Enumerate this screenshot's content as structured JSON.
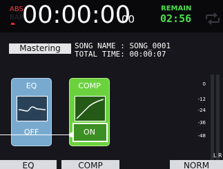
{
  "counter": {
    "abs_label": "ABS",
    "bar_label": "BAR",
    "time": "00:00:00",
    "frames": "00",
    "remain_label": "REMAIN",
    "remain_value": "02:56",
    "repeat_icon": "repeat-icon"
  },
  "song": {
    "mode_label": "Mastering",
    "name_line": "SONG NAME : SONG_0001",
    "time_line": "TOTAL TIME: 00:00:07"
  },
  "modules": {
    "eq": {
      "title": "EQ",
      "state": "OFF",
      "graph_icon": "eq-curve-icon"
    },
    "comp": {
      "title": "COMP",
      "state": "ON",
      "graph_icon": "comp-curve-icon"
    }
  },
  "meter": {
    "scale": [
      "0",
      "-12",
      "-24",
      "-36",
      "-48"
    ],
    "channels": "L R"
  },
  "function_buttons": {
    "eq": "EQ",
    "comp": "COMP",
    "norm": "NORM"
  },
  "colors": {
    "background": "#16161c",
    "eq_module": "#78aad0",
    "comp_module": "#6bd23e",
    "remain_green": "#49e04a",
    "abs_red": "#ff3b3b"
  }
}
